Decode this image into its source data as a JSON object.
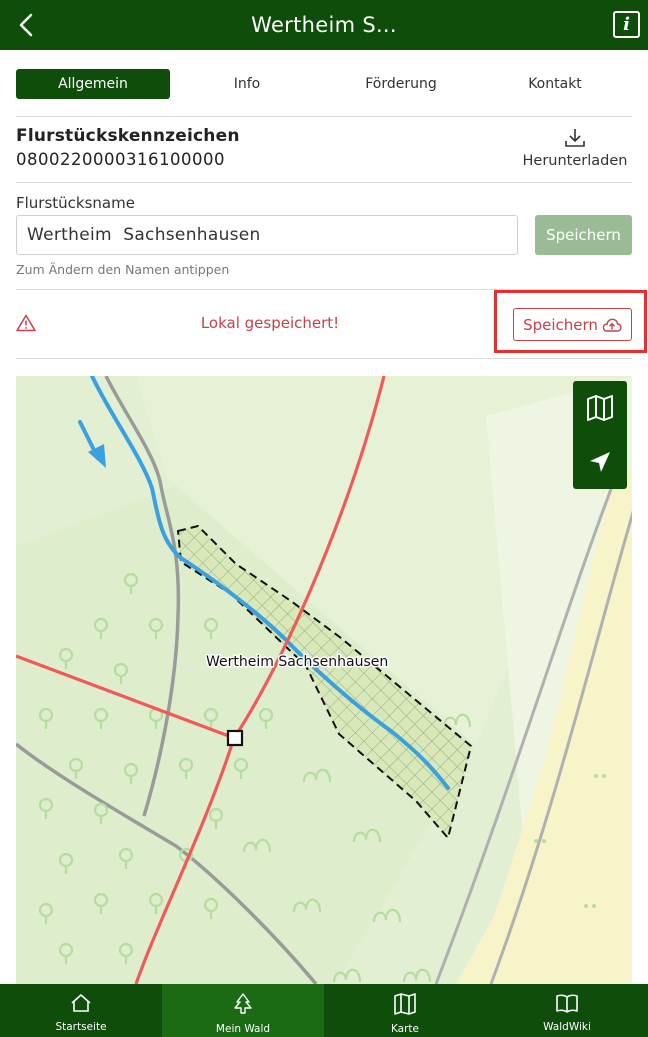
{
  "header": {
    "title": "Wertheim S...",
    "info_icon": "i"
  },
  "tabs": [
    {
      "label": "Allgemein",
      "active": true
    },
    {
      "label": "Info",
      "active": false
    },
    {
      "label": "Förderung",
      "active": false
    },
    {
      "label": "Kontakt",
      "active": false
    }
  ],
  "parcel": {
    "id_label": "Flurstückskennzeichen",
    "id_value": "0800220000316100000",
    "download_label": "Herunterladen"
  },
  "name_section": {
    "label": "Flurstücksname",
    "value": "Wertheim  Sachsenhausen",
    "save_label": "Speichern",
    "hint": "Zum Ändern den Namen antippen"
  },
  "status": {
    "message": "Lokal gespeichert!",
    "upload_label": "Speichern",
    "message_color": "#c8404a"
  },
  "map": {
    "parcel_label": "Wertheim Sachsenhausen",
    "controls": [
      "map-layers-icon",
      "locate-icon"
    ]
  },
  "bottom_nav": [
    {
      "label": "Startseite",
      "icon": "home-icon",
      "active": false
    },
    {
      "label": "Mein Wald",
      "icon": "tree-icon",
      "active": true
    },
    {
      "label": "Karte",
      "icon": "map-icon",
      "active": false
    },
    {
      "label": "WaldWiki",
      "icon": "book-icon",
      "active": false
    }
  ],
  "colors": {
    "brand": "#0e4e0a",
    "accent_active": "#1a6b14",
    "alert": "#c8404a",
    "highlight": "#e5302f"
  }
}
